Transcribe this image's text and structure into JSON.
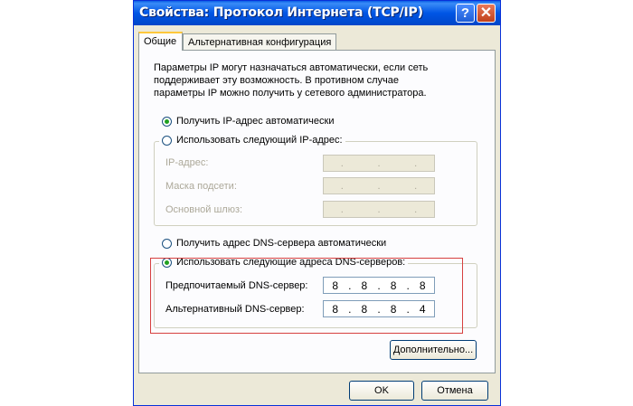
{
  "window": {
    "title": "Свойства: Протокол Интернета (TCP/IP)",
    "help_label": "?",
    "close_label": "✕"
  },
  "tabs": [
    {
      "label": "Общие"
    },
    {
      "label": "Альтернативная конфигурация"
    }
  ],
  "description": "Параметры IP могут назначаться автоматически, если сеть поддерживает эту возможность. В противном случае параметры IP можно получить у сетевого администратора.",
  "ip_section": {
    "auto_label": "Получить IP-адрес автоматически",
    "manual_label": "Использовать следующий IP-адрес:",
    "auto_selected": true,
    "fields": [
      {
        "label": "IP-адрес:",
        "value": ". . ."
      },
      {
        "label": "Маска подсети:",
        "value": ". . ."
      },
      {
        "label": "Основной шлюз:",
        "value": ". . ."
      }
    ]
  },
  "dns_section": {
    "auto_label": "Получить адрес DNS-сервера автоматически",
    "manual_label": "Использовать следующие адреса DNS-серверов:",
    "manual_selected": true,
    "preferred": {
      "label": "Предпочитаемый DNS-сервер:",
      "octets": [
        "8",
        "8",
        "8",
        "8"
      ]
    },
    "alternate": {
      "label": "Альтернативный DNS-сервер:",
      "octets": [
        "8",
        "8",
        "8",
        "4"
      ]
    }
  },
  "buttons": {
    "advanced": "Дополнительно...",
    "ok": "OK",
    "cancel": "Отмена"
  },
  "colors": {
    "title_bar": "#0055e5",
    "highlight_box": "#d64040",
    "radio_dot": "#21a121"
  }
}
